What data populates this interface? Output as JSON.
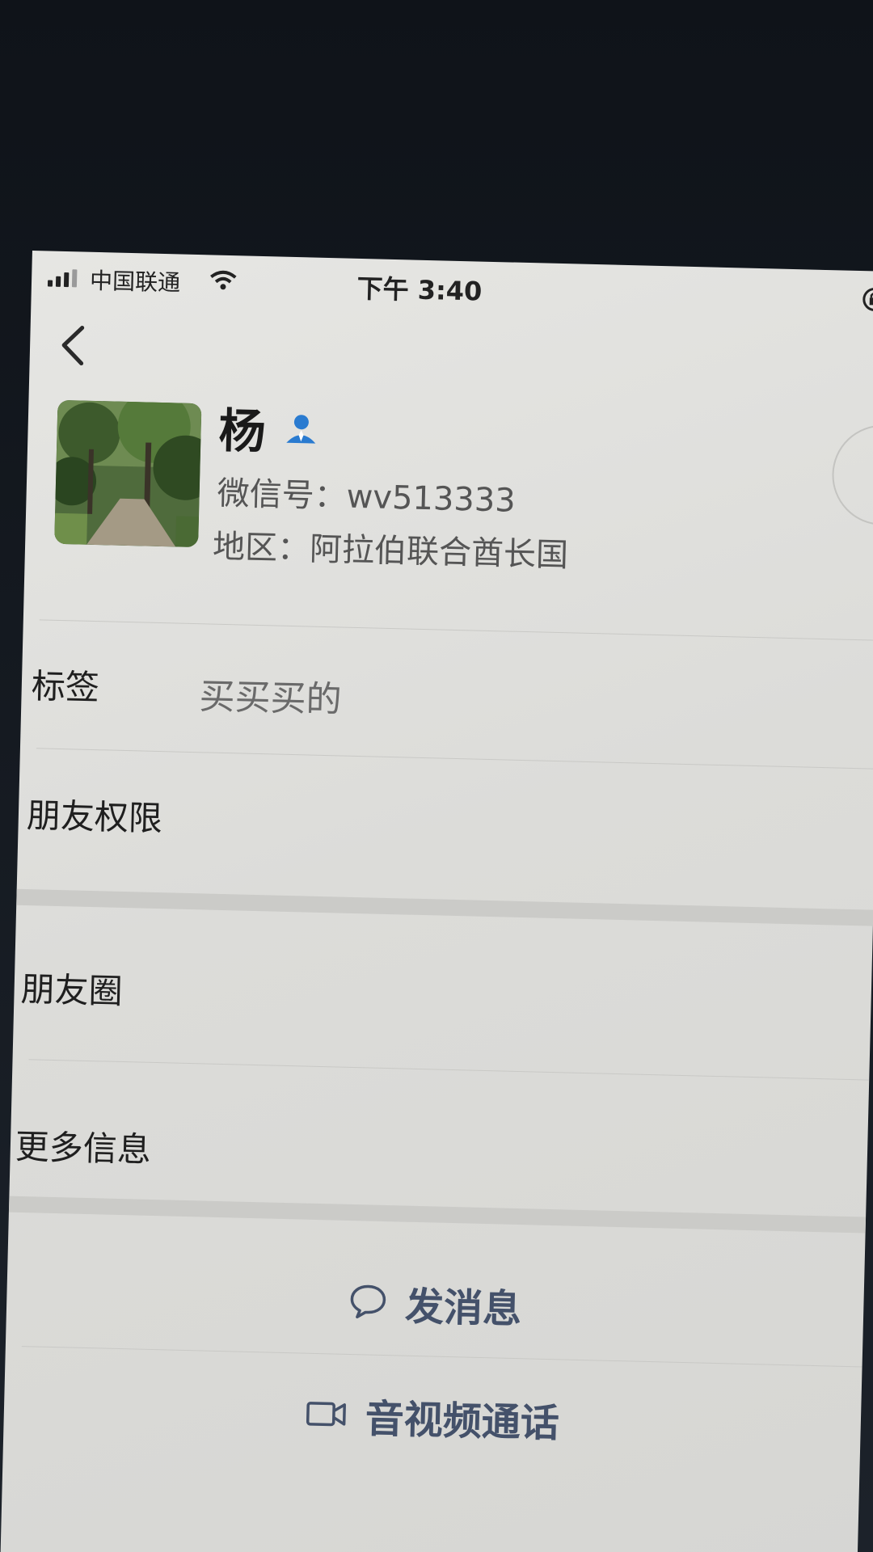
{
  "status_bar": {
    "carrier": "中国联通",
    "time": "下午 3:40"
  },
  "profile": {
    "name": "杨",
    "wechat_id": "微信号：wv513333",
    "region": "地区：阿拉伯联合酋长国"
  },
  "rows": {
    "tags_label": "标签",
    "tags_value": "买买买的",
    "friend_permissions": "朋友权限",
    "moments": "朋友圈",
    "more_info": "更多信息"
  },
  "actions": {
    "send_message": "发消息",
    "video_call": "音视频通话"
  },
  "colors": {
    "action_text": "#44516a",
    "verified_icon": "#2a7bd0",
    "screen_bg": "#e2e2df"
  },
  "icons": [
    "signal-icon",
    "wifi-icon",
    "orientation-lock-icon",
    "back-chevron-icon",
    "contact-person-icon",
    "chat-bubble-icon",
    "video-camera-icon"
  ]
}
